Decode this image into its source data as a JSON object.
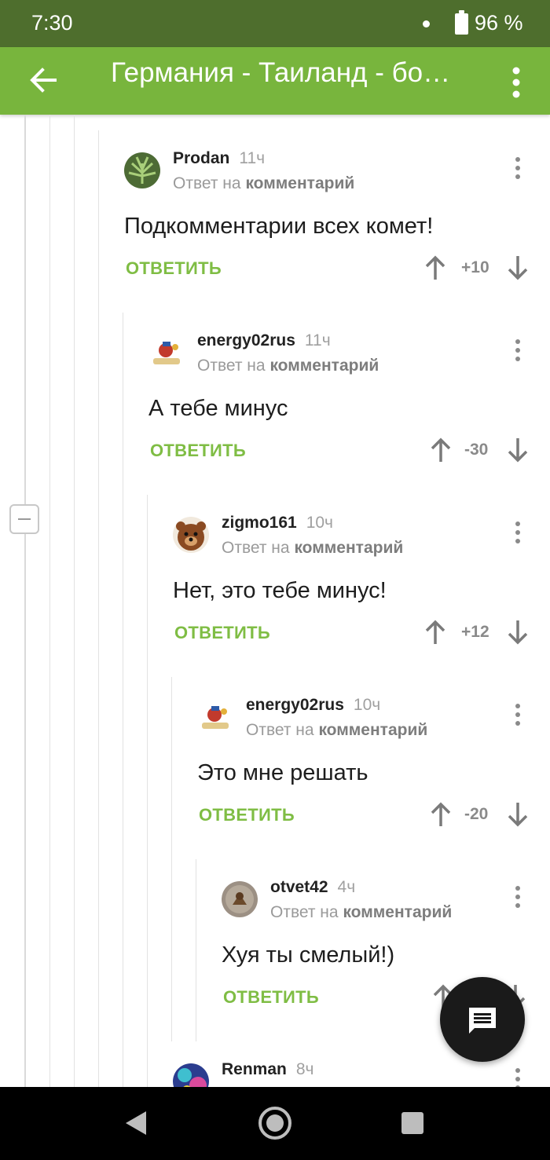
{
  "status_bar": {
    "time": "7:30",
    "battery": "96 %"
  },
  "app_bar": {
    "title": "Германия - Таиланд - бо…"
  },
  "comments": [
    {
      "author": "Prodan",
      "time": "11ч",
      "reply_prefix": "Ответ на",
      "reply_link": "комментарий",
      "text": "Подкомментарии всех комет!",
      "answer": "ОТВЕТИТЬ",
      "rating": "+10"
    },
    {
      "author": "energy02rus",
      "time": "11ч",
      "reply_prefix": "Ответ на",
      "reply_link": "комментарий",
      "text": "А тебе минус",
      "answer": "ОТВЕТИТЬ",
      "rating": "-30"
    },
    {
      "author": "zigmo161",
      "time": "10ч",
      "reply_prefix": "Ответ на",
      "reply_link": "комментарий",
      "text": "Нет, это тебе минус!",
      "answer": "ОТВЕТИТЬ",
      "rating": "+12"
    },
    {
      "author": "energy02rus",
      "time": "10ч",
      "reply_prefix": "Ответ на",
      "reply_link": "комментарий",
      "text": "Это мне решать",
      "answer": "ОТВЕТИТЬ",
      "rating": "-20"
    },
    {
      "author": "otvet42",
      "time": "4ч",
      "reply_prefix": "Ответ на",
      "reply_link": "комментарий",
      "text": "Хуя ты смелый!)",
      "answer": "ОТВЕТИТЬ",
      "rating": ""
    },
    {
      "author": "Renman",
      "time": "8ч"
    }
  ],
  "colors": {
    "status_bar": "#4e6e2d",
    "app_bar": "#78b53d",
    "accent": "#7fbd44",
    "fab": "#1a1a1a"
  },
  "icons": {
    "back": "arrow-back-icon",
    "menu": "more-vert-icon",
    "fab": "comment-icon",
    "upvote": "arrow-up-icon",
    "downvote": "arrow-down-icon",
    "collapse": "minus-icon"
  }
}
